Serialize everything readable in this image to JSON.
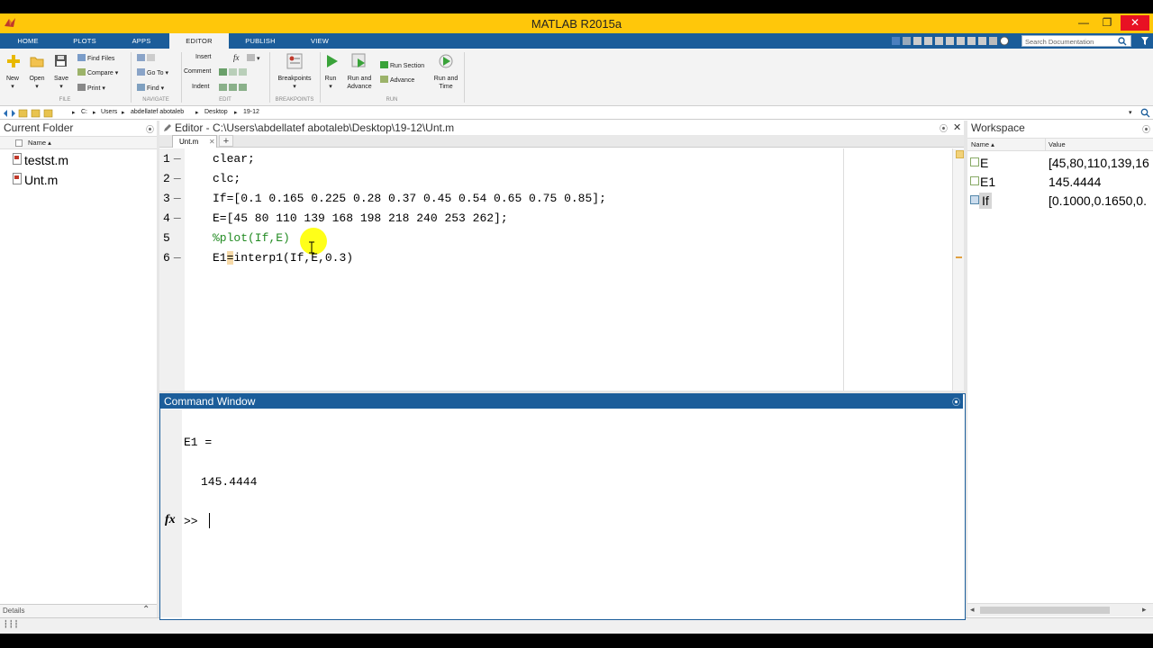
{
  "window": {
    "title": "MATLAB R2015a"
  },
  "tabs": [
    {
      "label": "HOME"
    },
    {
      "label": "PLOTS"
    },
    {
      "label": "APPS"
    },
    {
      "label": "EDITOR"
    },
    {
      "label": "PUBLISH"
    },
    {
      "label": "VIEW"
    }
  ],
  "search": {
    "placeholder": "Search Documentation"
  },
  "ribbon": {
    "file": {
      "new": "New",
      "open": "Open",
      "save": "Save",
      "find_files": "Find Files",
      "compare": "Compare",
      "print": "Print",
      "group": "FILE"
    },
    "navigate": {
      "goto": "Go To",
      "find": "Find",
      "group": "NAVIGATE"
    },
    "edit": {
      "insert": "Insert",
      "comment": "Comment",
      "indent": "Indent",
      "fx": "fx",
      "group": "EDIT"
    },
    "breakpoints": {
      "label": "Breakpoints",
      "group": "BREAKPOINTS"
    },
    "run": {
      "run": "Run",
      "run_advance_1": "Run and",
      "run_advance_2": "Advance",
      "run_section": "Run Section",
      "advance": "Advance",
      "run_time_1": "Run and",
      "run_time_2": "Time",
      "group": "RUN"
    }
  },
  "breadcrumb": [
    "C:",
    "Users",
    "abdellatef abotaleb",
    "Desktop",
    "19-12"
  ],
  "current_folder": {
    "title": "Current Folder",
    "col_name": "Name ▴",
    "files": [
      "testst.m",
      "Unt.m"
    ],
    "details": "Details"
  },
  "editor": {
    "title": "Editor - C:\\Users\\abdellatef abotaleb\\Desktop\\19-12\\Unt.m",
    "tab": "Unt.m",
    "lines": [
      {
        "num": "1",
        "code": "clear;"
      },
      {
        "num": "2",
        "code": "clc;"
      },
      {
        "num": "3",
        "code": "If=[0.1 0.165 0.225 0.28 0.37 0.45 0.54 0.65 0.75 0.85];"
      },
      {
        "num": "4",
        "code": "E=[45 80 110 139 168 198 218 240 253 262];"
      },
      {
        "num": "5",
        "code": "%plot(If,E)"
      },
      {
        "num": "6",
        "code_a": "E1",
        "code_b": "=",
        "code_c": "interp1(If,E,0.3)"
      }
    ]
  },
  "command_window": {
    "title": "Command Window",
    "out_var": "E1 =",
    "out_value": "145.4444",
    "fx": "fx",
    "prompt": ">>"
  },
  "workspace": {
    "title": "Workspace",
    "col_name": "Name ▴",
    "col_value": "Value",
    "vars": [
      {
        "name": "E",
        "value": "[45,80,110,139,16"
      },
      {
        "name": "E1",
        "value": "145.4444"
      },
      {
        "name": "If",
        "value": "[0.1000,0.1650,0."
      }
    ]
  },
  "colors": {
    "accent": "#1b5d9a",
    "titlebar": "#ffc70a",
    "comment": "#228b22",
    "cursor_highlight": "#ffff00"
  }
}
